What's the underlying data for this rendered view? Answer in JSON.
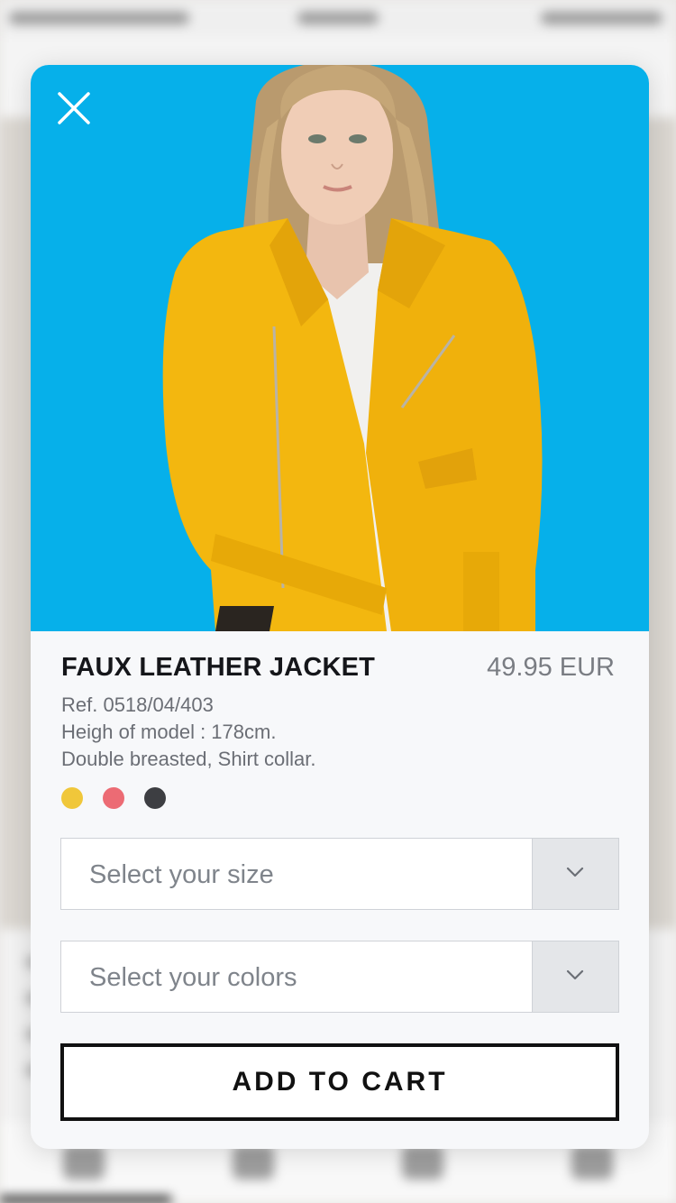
{
  "product": {
    "title": "FAUX LEATHER JACKET",
    "price": "49.95 EUR",
    "ref": "Ref. 0518/04/403",
    "model_height": "Heigh of model : 178cm.",
    "description": "Double breasted, Shirt collar."
  },
  "swatches": [
    {
      "name": "yellow",
      "color": "#f0c73a"
    },
    {
      "name": "coral",
      "color": "#ec6b74"
    },
    {
      "name": "charcoal",
      "color": "#3d3e42"
    }
  ],
  "size_select": {
    "placeholder": "Select your size"
  },
  "color_select": {
    "placeholder": "Select your colors"
  },
  "cart_button": {
    "label": "ADD TO CART"
  },
  "icons": {
    "close": "close-icon",
    "chevron": "chevron-down-icon"
  },
  "colors": {
    "hero_background": "#06b0ea",
    "jacket": "#f3b70f",
    "card_background": "#f7f8fa"
  }
}
